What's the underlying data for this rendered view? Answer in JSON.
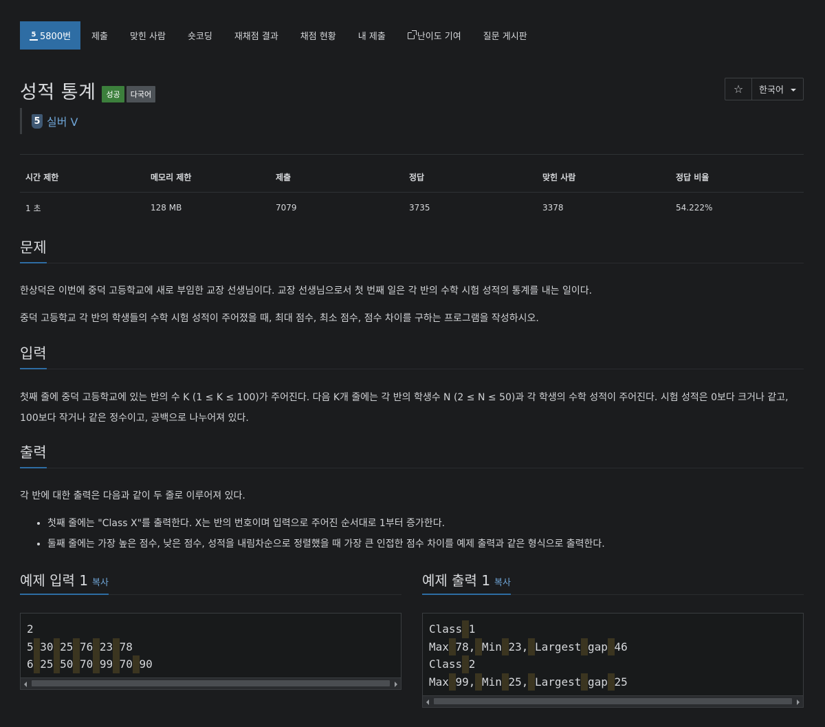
{
  "nav": {
    "items": [
      {
        "label": "5800번",
        "tier_glyph": "5"
      },
      {
        "label": "제출"
      },
      {
        "label": "맞힌 사람"
      },
      {
        "label": "숏코딩"
      },
      {
        "label": "재채점 결과"
      },
      {
        "label": "채점 현황"
      },
      {
        "label": "내 제출"
      },
      {
        "label": "난이도 기여",
        "icon": "external-link-icon"
      },
      {
        "label": "질문 게시판"
      }
    ]
  },
  "problem": {
    "title": "성적 통계",
    "badges": {
      "success": "성공",
      "multilang": "다국어"
    },
    "tier": {
      "glyph": "5",
      "label": "실버 V"
    }
  },
  "tools": {
    "star": "☆",
    "language": "한국어"
  },
  "stats": {
    "headers": [
      "시간 제한",
      "메모리 제한",
      "제출",
      "정답",
      "맞힌 사람",
      "정답 비율"
    ],
    "values": [
      "1 초",
      "128 MB",
      "7079",
      "3735",
      "3378",
      "54.222%"
    ]
  },
  "sections": {
    "problem": {
      "heading": "문제",
      "paragraphs": [
        "한상덕은 이번에 중덕 고등학교에 새로 부임한 교장 선생님이다. 교장 선생님으로서 첫 번째 일은 각 반의 수학 시험 성적의 통계를 내는 일이다.",
        "중덕 고등학교 각 반의 학생들의 수학 시험 성적이 주어졌을 때, 최대 점수, 최소 점수, 점수 차이를 구하는 프로그램을 작성하시오."
      ]
    },
    "input": {
      "heading": "입력",
      "paragraph": "첫째 줄에 중덕 고등학교에 있는 반의 수 K (1 ≤ K ≤ 100)가 주어진다. 다음 K개 줄에는 각 반의 학생수 N (2 ≤ N ≤ 50)과 각 학생의 수학 성적이 주어진다. 시험 성적은 0보다 크거나 같고, 100보다 작거나 같은 정수이고, 공백으로 나누어져 있다."
    },
    "output": {
      "heading": "출력",
      "paragraph": "각 반에 대한 출력은 다음과 같이 두 줄로 이루어져 있다.",
      "bullets": [
        "첫째 줄에는 \"Class X\"를 출력한다. X는 반의 번호이며 입력으로 주어진 순서대로 1부터 증가한다.",
        "둘째 줄에는 가장 높은 점수, 낮은 점수, 성적을 내림차순으로 정렬했을 때 가장 큰 인접한 점수 차이를 예제 출력과 같은 형식으로 출력한다."
      ]
    }
  },
  "samples": {
    "copy_label": "복사",
    "input": {
      "heading": "예제 입력 1",
      "lines": [
        "2",
        "5 30 25 76 23 78",
        "6 25 50 70 99 70 90"
      ]
    },
    "output": {
      "heading": "예제 출력 1",
      "lines": [
        "Class 1",
        "Max 78, Min 23, Largest gap 46",
        "Class 2",
        "Max 99, Min 25, Largest gap 25"
      ]
    }
  }
}
